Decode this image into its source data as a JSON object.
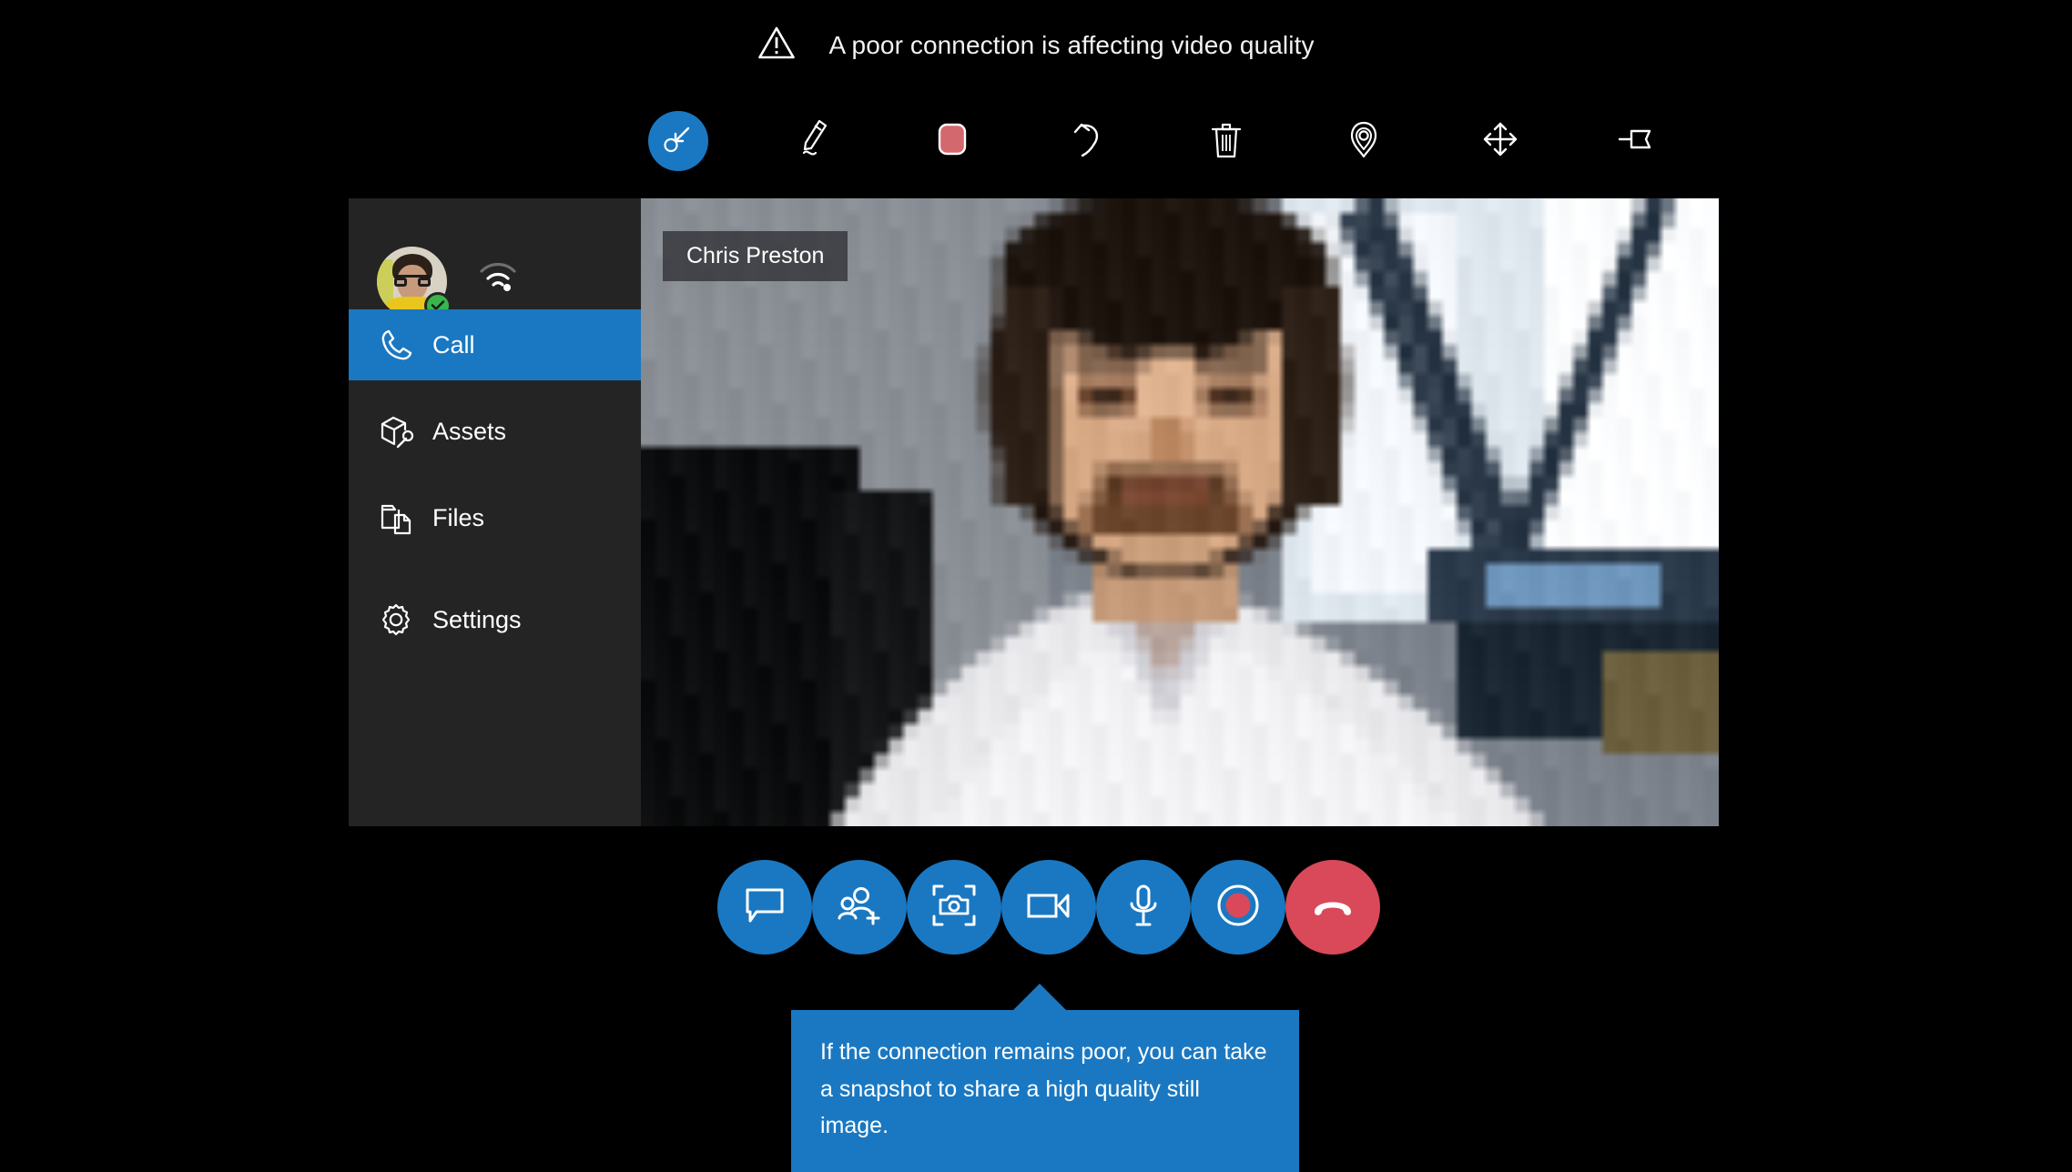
{
  "warning": {
    "icon": "warning-triangle-icon",
    "text": "A poor connection is affecting video quality"
  },
  "toolbar": {
    "items": [
      {
        "name": "pointer-annotation-tool",
        "icon": "arrow-pointer-icon",
        "active": true
      },
      {
        "name": "pen-tool",
        "icon": "pen-icon",
        "active": false
      },
      {
        "name": "color-swatch-red",
        "icon": "red-color-swatch-icon",
        "active": false,
        "color": "#d4686f"
      },
      {
        "name": "undo-tool",
        "icon": "undo-arrow-icon",
        "active": false
      },
      {
        "name": "delete-tool",
        "icon": "trash-can-icon",
        "active": false
      },
      {
        "name": "place-marker-tool",
        "icon": "location-pin-icon",
        "active": false
      },
      {
        "name": "move-tool",
        "icon": "move-arrows-icon",
        "active": false
      },
      {
        "name": "pin-tool",
        "icon": "push-pin-icon",
        "active": false
      }
    ]
  },
  "sidebar": {
    "profile": {
      "avatar": "user-avatar",
      "presence": "available-check-icon",
      "signal": "wifi-signal-icon",
      "signal_bars_lit": 2,
      "signal_bars_total": 3
    },
    "items": [
      {
        "label": "Call",
        "icon": "phone-handset-icon",
        "active": true
      },
      {
        "label": "Assets",
        "icon": "box-wrench-icon",
        "active": false
      },
      {
        "label": "Files",
        "icon": "files-folder-icon",
        "active": false
      },
      {
        "label": "Settings",
        "icon": "gear-icon",
        "active": false
      }
    ]
  },
  "video": {
    "participant_name": "Chris Preston"
  },
  "controls": {
    "buttons": [
      {
        "name": "chat-button",
        "icon": "chat-bubble-icon",
        "style": "primary"
      },
      {
        "name": "add-people-button",
        "icon": "add-person-icon",
        "style": "primary"
      },
      {
        "name": "snapshot-button",
        "icon": "camera-capture-icon",
        "style": "primary"
      },
      {
        "name": "video-button",
        "icon": "video-camera-icon",
        "style": "primary"
      },
      {
        "name": "microphone-button",
        "icon": "microphone-icon",
        "style": "primary"
      },
      {
        "name": "record-button",
        "icon": "record-circle-icon",
        "style": "primary"
      },
      {
        "name": "end-call-button",
        "icon": "end-call-icon",
        "style": "danger"
      }
    ]
  },
  "tooltip": {
    "text": "If the connection remains poor, you can take a snapshot to share a high quality still image."
  },
  "colors": {
    "accent_blue": "#1a78c2",
    "danger_red": "#d9495a",
    "panel_dark": "#242424",
    "background": "#000000",
    "presence_green": "#3ab54a",
    "swatch_red": "#d4686f"
  }
}
